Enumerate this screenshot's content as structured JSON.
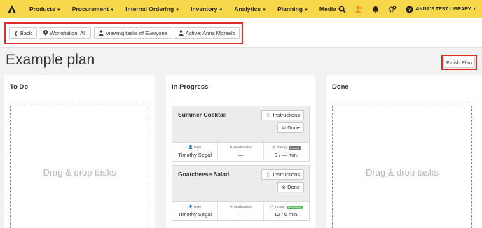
{
  "nav": {
    "items": [
      {
        "label": "Products"
      },
      {
        "label": "Procurement"
      },
      {
        "label": "Internal Ordering"
      },
      {
        "label": "Inventory"
      },
      {
        "label": "Analytics"
      },
      {
        "label": "Planning"
      },
      {
        "label": "Media"
      }
    ],
    "icons": [
      "search-icon",
      "user-group-icon",
      "bell-icon",
      "gear-icon",
      "help-icon"
    ],
    "library": "ANNA'S TEST LIBRARY"
  },
  "toolbar": {
    "back": "Back",
    "workstation": "Workstation: All",
    "viewing": "Viewing tasks of Everyone",
    "active": "Active: Anna Moreels"
  },
  "page": {
    "title": "Example plan",
    "finish": "Finish Plan"
  },
  "columns": {
    "todo": {
      "title": "To Do",
      "placeholder": "Drag & drop tasks"
    },
    "progress": {
      "title": "In Progress"
    },
    "done": {
      "title": "Done",
      "placeholder": "Drag & drop tasks"
    }
  },
  "cards": [
    {
      "name": "Summer Cocktail",
      "instructions": "Instructions",
      "done": "Done",
      "user_label": "User",
      "user": "Timothy Segal",
      "ws_label": "Workstation",
      "ws": "—",
      "timing_label": "Timing",
      "timing_badge": "Paused",
      "timing": "0 / — min."
    },
    {
      "name": "Goatcheese Salad",
      "instructions": "Instructions",
      "done": "Done",
      "user_label": "User",
      "user": "Timothy Segal",
      "ws_label": "Workstation",
      "ws": "—",
      "timing_label": "Timing",
      "timing_badge": "Recording",
      "timing": "12 / 6 min."
    }
  ]
}
